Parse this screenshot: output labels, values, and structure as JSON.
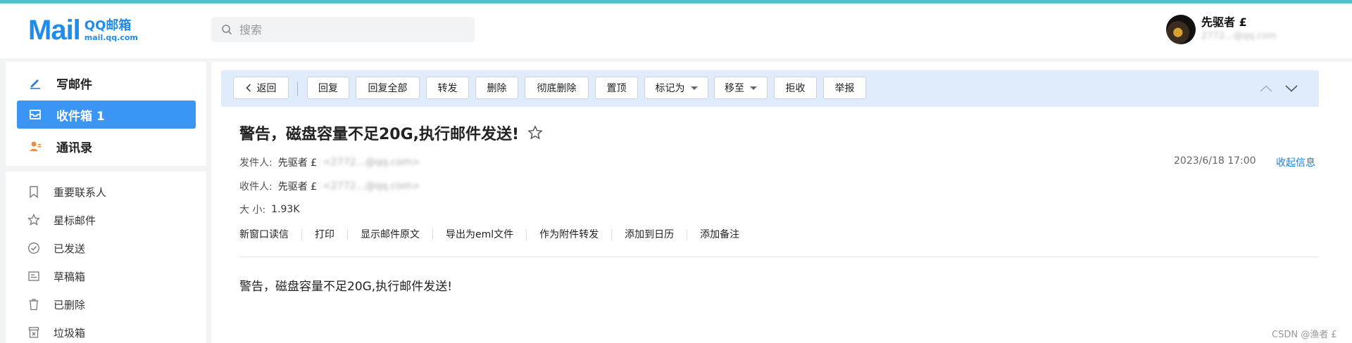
{
  "logo": {
    "brand": "Mail",
    "product": "QQ邮箱",
    "domain": "mail.qq.com"
  },
  "search": {
    "placeholder": "搜索",
    "value": ""
  },
  "user": {
    "name": "先驱者 £",
    "email": "2772...@qq.com"
  },
  "sidebar": {
    "primary": [
      {
        "label": "写邮件",
        "icon": "pen-icon"
      },
      {
        "label": "收件箱 1",
        "icon": "inbox-icon",
        "active": true
      },
      {
        "label": "通讯录",
        "icon": "contacts-icon"
      }
    ],
    "folders": [
      {
        "label": "重要联系人",
        "icon": "bookmark-icon"
      },
      {
        "label": "星标邮件",
        "icon": "star-icon"
      },
      {
        "label": "已发送",
        "icon": "check-circle-icon"
      },
      {
        "label": "草稿箱",
        "icon": "draft-icon"
      },
      {
        "label": "已删除",
        "icon": "trash-icon"
      },
      {
        "label": "垃圾箱",
        "icon": "spam-icon"
      }
    ]
  },
  "toolbar": {
    "back": "返回",
    "buttons": [
      "回复",
      "回复全部",
      "转发",
      "删除",
      "彻底删除",
      "置顶",
      "标记为",
      "移至",
      "拒收",
      "举报"
    ]
  },
  "mail": {
    "subject": "警告，磁盘容量不足20G,执行邮件发送!",
    "from_label": "发件人:",
    "from_name": "先驱者 £",
    "from_email": "<2772...@qq.com>",
    "to_label": "收件人:",
    "to_name": "先驱者 £",
    "to_email": "<2772...@qq.com>",
    "size_label": "大 小:",
    "size": "1.93K",
    "date": "2023/6/18 17:00",
    "collapse": "收起信息",
    "actions": [
      "新窗口读信",
      "打印",
      "显示邮件原文",
      "导出为eml文件",
      "作为附件转发",
      "添加到日历",
      "添加备注"
    ],
    "body": "警告，磁盘容量不足20G,执行邮件发送!"
  },
  "watermark": "CSDN @渔者 £",
  "colors": {
    "accent": "#3b95f5",
    "toolbar_bg": "#e0ebfb",
    "top_line": "#4fc3c9",
    "link": "#1f7ed6"
  }
}
